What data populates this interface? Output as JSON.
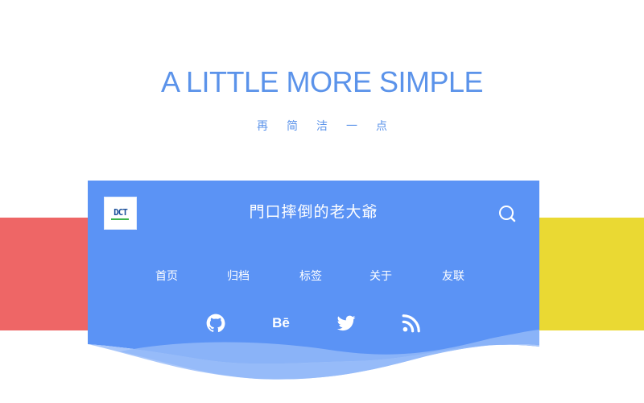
{
  "hero": {
    "title": "A LITTLE MORE SIMPLE",
    "subtitle": "再简洁一点"
  },
  "header": {
    "logo_text": "DCT",
    "site_title": "門口摔倒的老大爺",
    "search_icon": "search-icon"
  },
  "nav": {
    "items": [
      {
        "label": "首页"
      },
      {
        "label": "归档"
      },
      {
        "label": "标签"
      },
      {
        "label": "关于"
      },
      {
        "label": "友联"
      }
    ]
  },
  "social": {
    "items": [
      {
        "icon": "github-icon"
      },
      {
        "icon": "behance-icon",
        "label": "Bē"
      },
      {
        "icon": "twitter-icon"
      },
      {
        "icon": "rss-icon"
      }
    ]
  },
  "colors": {
    "accent": "#5b93ea",
    "card": "#5b93f5",
    "red_block": "#ee6666",
    "yellow_block": "#ead933",
    "text_light": "#ffffff"
  }
}
